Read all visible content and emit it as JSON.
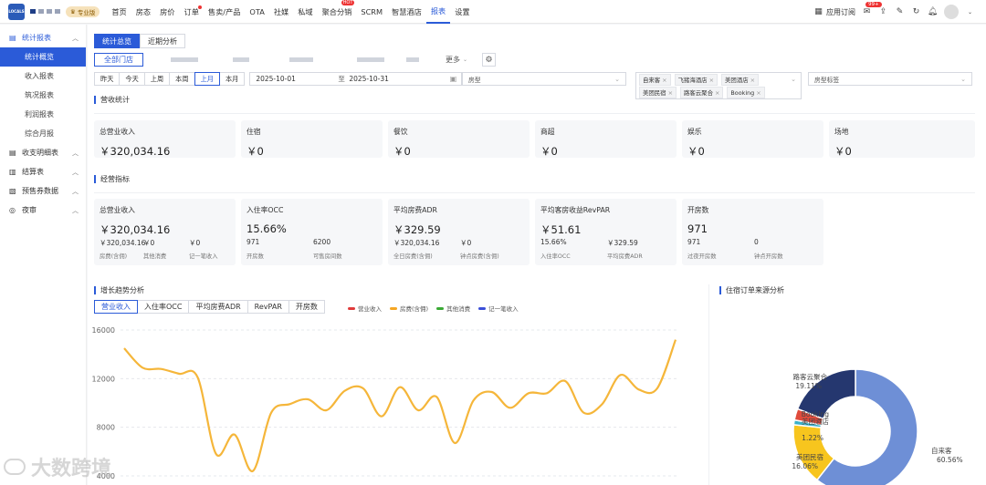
{
  "nav": {
    "logo_text": "LOCALS",
    "pro_badge": "专业版",
    "items": [
      "首页",
      "房态",
      "房价",
      "订单",
      "售卖/产品",
      "OTA",
      "社媒",
      "私域",
      "聚合分销",
      "SCRM",
      "智慧酒店",
      "报表",
      "设置"
    ],
    "hot_label": "HOT",
    "subscription": "应用订阅",
    "message_badge": "99+"
  },
  "sidebar": {
    "groups": [
      {
        "label": "统计报表",
        "icon": "report-icon"
      },
      {
        "label": "收支明细表",
        "icon": "ledger-icon"
      },
      {
        "label": "结算表",
        "icon": "settlement-icon"
      },
      {
        "label": "预售券数据",
        "icon": "coupon-icon"
      },
      {
        "label": "夜审",
        "icon": "night-audit-icon"
      }
    ],
    "subitems": [
      "统计概览",
      "收入报表",
      "筑况报表",
      "利润报表",
      "综合月报"
    ]
  },
  "tabs": [
    "统计总览",
    "近期分析"
  ],
  "store": {
    "all": "全部门店",
    "more": "更多"
  },
  "date": {
    "quick": [
      "昨天",
      "今天",
      "上周",
      "本周",
      "上月",
      "本月"
    ],
    "start": "2025-10-01",
    "to": "至",
    "end": "2025-10-31"
  },
  "filters": {
    "room_type_placeholder": "房型",
    "room_tag_placeholder": "房型标签",
    "channels": [
      "自来客",
      "飞猪海酒店",
      "美团酒店",
      "美团民宿",
      "路客云聚合",
      "Booking"
    ]
  },
  "revenue": {
    "title": "营收统计",
    "cards": [
      {
        "label": "总营业收入",
        "value": "￥320,034.16"
      },
      {
        "label": "住宿",
        "value": "￥0"
      },
      {
        "label": "餐饮",
        "value": "￥0"
      },
      {
        "label": "商超",
        "value": "￥0"
      },
      {
        "label": "娱乐",
        "value": "￥0"
      },
      {
        "label": "场地",
        "value": "￥0"
      }
    ]
  },
  "kpi": {
    "title": "经营指标",
    "cards": [
      {
        "label": "总营业收入",
        "value": "￥320,034.16",
        "subs": [
          {
            "v": "￥320,034.16",
            "l": "房费(含佣)"
          },
          {
            "v": "￥0",
            "l": "其他消费"
          },
          {
            "v": "￥0",
            "l": "记一笔收入"
          }
        ]
      },
      {
        "label": "入住率OCC",
        "value": "15.66%",
        "subs": [
          {
            "v": "971",
            "l": "开房数"
          },
          {
            "v": "6200",
            "l": "可售房间数"
          }
        ]
      },
      {
        "label": "平均房费ADR",
        "value": "￥329.59",
        "subs": [
          {
            "v": "￥320,034.16",
            "l": "全日房费(含佣)"
          },
          {
            "v": "￥0",
            "l": "钟点房费(含佣)"
          }
        ]
      },
      {
        "label": "平均客房收益RevPAR",
        "value": "￥51.61",
        "subs": [
          {
            "v": "15.66%",
            "l": "入住率OCC"
          },
          {
            "v": "￥329.59",
            "l": "平均房费ADR"
          }
        ]
      },
      {
        "label": "开房数",
        "value": "971",
        "subs": [
          {
            "v": "971",
            "l": "过夜开房数"
          },
          {
            "v": "0",
            "l": "钟点开房数"
          }
        ]
      }
    ]
  },
  "trend": {
    "title": "增长趋势分析",
    "tabs": [
      "营业收入",
      "入住率OCC",
      "平均房费ADR",
      "RevPAR",
      "开房数"
    ],
    "legend": [
      {
        "name": "营业收入",
        "color": "#e03b3b"
      },
      {
        "name": "房费(含佣)",
        "color": "#f5a623"
      },
      {
        "name": "其他消费",
        "color": "#3aaa35"
      },
      {
        "name": "记一笔收入",
        "color": "#3b4fd8"
      }
    ]
  },
  "chart_data": [
    {
      "type": "line",
      "title": "增长趋势分析",
      "ylim": [
        4000,
        16000
      ],
      "yticks": [
        "16000",
        "12000",
        "8000",
        "4000"
      ],
      "series": [
        {
          "name": "房费(含佣)",
          "color": "#f5b63a",
          "values": [
            14500,
            12900,
            12800,
            12400,
            12100,
            5800,
            7400,
            4400,
            9200,
            9900,
            10300,
            9400,
            11000,
            11200,
            8900,
            11300,
            9400,
            10500,
            6700,
            10200,
            10900,
            9600,
            10800,
            10800,
            11800,
            9200,
            9900,
            12300,
            11100,
            11200,
            15200
          ]
        }
      ]
    },
    {
      "type": "pie",
      "title": "住宿订单来源分析",
      "slices": [
        {
          "name": "自来客",
          "value": 60.56,
          "pct": "60.56%",
          "color": "#6e8fd6"
        },
        {
          "name": "美团民宿",
          "value": 16.06,
          "pct": "16.06%",
          "color": "#f7c51e"
        },
        {
          "name": "美团酒店",
          "value": 1.22,
          "pct": "1.22%",
          "color": "#3bb1c9"
        },
        {
          "name": "Booking",
          "value": 2.97,
          "pct": "",
          "color": "#e04b3c"
        },
        {
          "name": "路客云聚合",
          "value": 19.11,
          "pct": "19.11%",
          "color": "#25376f"
        }
      ]
    }
  ],
  "source_title": "住宿订单来源分析",
  "watermark": "大数跨境"
}
